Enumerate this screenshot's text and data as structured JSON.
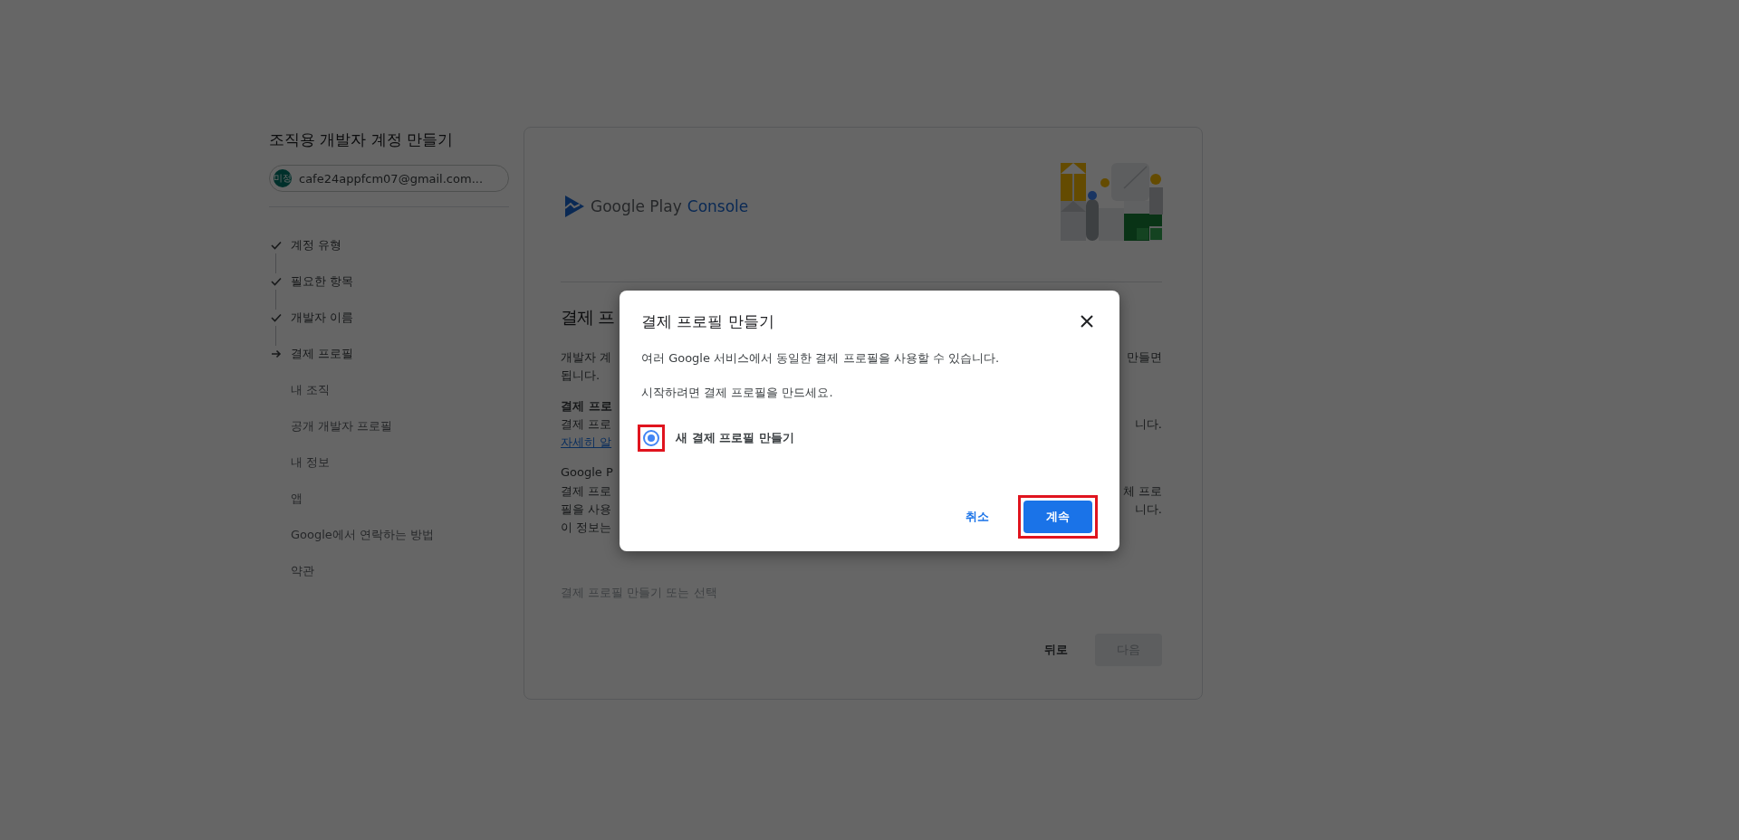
{
  "sidebar": {
    "title": "조직용 개발자 계정 만들기",
    "account": {
      "avatar": "미정",
      "email": "cafe24appfcm07@gmail.com..."
    },
    "steps": [
      {
        "label": "계정 유형",
        "kind": "done"
      },
      {
        "label": "필요한 항목",
        "kind": "done"
      },
      {
        "label": "개발자 이름",
        "kind": "done"
      },
      {
        "label": "결제 프로필",
        "kind": "current"
      },
      {
        "label": "내 조직",
        "kind": "pending"
      },
      {
        "label": "공개 개발자 프로필",
        "kind": "pending"
      },
      {
        "label": "내 정보",
        "kind": "pending"
      },
      {
        "label": "앱",
        "kind": "pending"
      },
      {
        "label": "Google에서 연락하는 방법",
        "kind": "pending"
      },
      {
        "label": "약관",
        "kind": "pending"
      }
    ]
  },
  "card": {
    "logo": {
      "brand": "Google Play",
      "product": "Console"
    },
    "heading": "결제 프",
    "paragraphs": [
      {
        "lines": [
          {
            "left": "개발자 계",
            "right": "만들면",
            "kind": "text"
          },
          {
            "left": "됩니다.",
            "kind": "text"
          }
        ]
      },
      {
        "lines": [
          {
            "left": "결제 프로",
            "kind": "bold"
          },
          {
            "left": "결제 프로",
            "right": "니다.",
            "kind": "text"
          },
          {
            "left": "자세히 알",
            "kind": "link"
          }
        ]
      },
      {
        "lines": [
          {
            "left": "Google P",
            "kind": "subhead"
          },
          {
            "left": "결제 프로",
            "right": "체 프로",
            "kind": "text"
          },
          {
            "left": "필을 사용",
            "right": "니다.",
            "kind": "text"
          },
          {
            "left": "이 정보는",
            "kind": "text"
          }
        ]
      }
    ],
    "field_label": "결제 프로필 만들기 또는 선택",
    "back_button": "뒤로",
    "next_button": {
      "label": "다음",
      "disabled": true
    }
  },
  "dialog": {
    "title": "결제 프로필 만들기",
    "paragraphs": [
      "여러 Google 서비스에서 동일한 결제 프로필을 사용할 수 있습니다.",
      "시작하려면 결제 프로필을 만드세요."
    ],
    "options": [
      {
        "label": "새 결제 프로필 만들기",
        "selected": true,
        "highlighted": true
      }
    ],
    "cancel_button": "취소",
    "continue_button": {
      "label": "계속",
      "highlighted": true
    }
  }
}
